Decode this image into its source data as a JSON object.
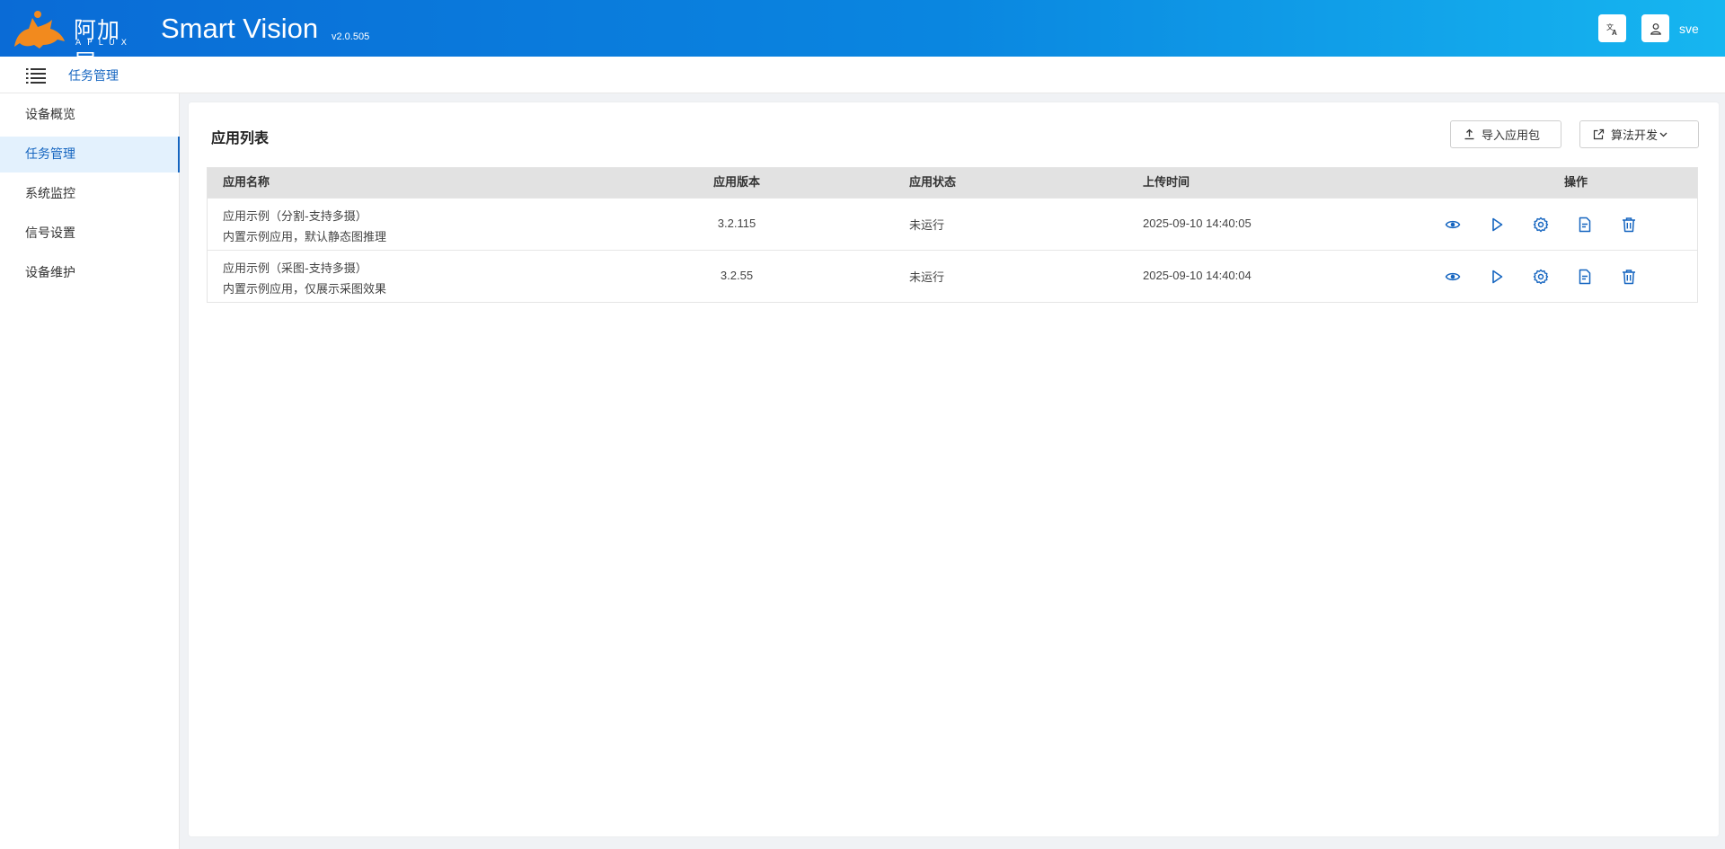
{
  "header": {
    "logo_cn": "阿加犀",
    "logo_en": "APLUX",
    "app_title": "Smart Vision",
    "version": "v2.0.505",
    "translate_icon": "translate-icon",
    "user_icon": "user-icon",
    "username": "sve"
  },
  "subbar": {
    "breadcrumb": "任务管理"
  },
  "sidebar": {
    "items": [
      {
        "label": "设备概览",
        "active": false
      },
      {
        "label": "任务管理",
        "active": true
      },
      {
        "label": "系统监控",
        "active": false
      },
      {
        "label": "信号设置",
        "active": false
      },
      {
        "label": "设备维护",
        "active": false
      }
    ]
  },
  "panel": {
    "title": "应用列表",
    "import_label": "导入应用包",
    "algo_label": "算法开发"
  },
  "table": {
    "columns": [
      "应用名称",
      "应用版本",
      "应用状态",
      "上传时间",
      "操作"
    ],
    "rows": [
      {
        "name": "应用示例（分割-支持多摄）",
        "desc": "内置示例应用，默认静态图推理",
        "version": "3.2.115",
        "status": "未运行",
        "time": "2025-09-10 14:40:05"
      },
      {
        "name": "应用示例（采图-支持多摄）",
        "desc": "内置示例应用，仅展示采图效果",
        "version": "3.2.55",
        "status": "未运行",
        "time": "2025-09-10 14:40:04"
      }
    ],
    "actions": [
      "view-icon",
      "play-icon",
      "settings-icon",
      "document-icon",
      "delete-icon"
    ]
  },
  "colors": {
    "header_start": "#0a6bd6",
    "header_end": "#16b6f0",
    "accent": "#1565c0",
    "logo_orange": "#f28a1e"
  }
}
